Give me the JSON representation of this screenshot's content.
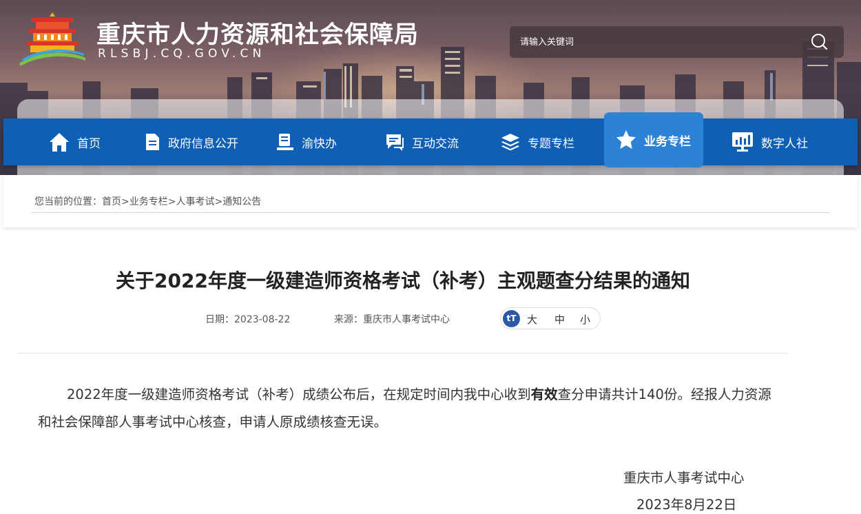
{
  "header": {
    "title": "重庆市人力资源和社会保障局",
    "domain": "RLSBJ.CQ.GOV.CN",
    "search": {
      "placeholder": "请输入关键词"
    }
  },
  "nav": {
    "items": [
      {
        "label": "首页",
        "icon": "home-icon"
      },
      {
        "label": "政府信息公开",
        "icon": "document-icon"
      },
      {
        "label": "渝快办",
        "icon": "service-icon"
      },
      {
        "label": "互动交流",
        "icon": "chat-icon"
      },
      {
        "label": "专题专栏",
        "icon": "layers-icon"
      },
      {
        "label": "业务专栏",
        "icon": "star-icon",
        "active": true
      },
      {
        "label": "数字人社",
        "icon": "monitor-chart-icon"
      }
    ]
  },
  "breadcrumb": {
    "prefix": "您当前的位置：",
    "items": [
      "首页",
      "业务专栏",
      "人事考试",
      "通知公告"
    ],
    "separator": ">"
  },
  "article": {
    "title": "关于2022年度一级建造师资格考试（补考）主观题查分结果的通知",
    "date": "日期：2023-08-22",
    "source": "来源：重庆市人事考试中心",
    "font_sizes": [
      "大",
      "中",
      "小"
    ],
    "body_before": "2022年度一级建造师资格考试（补考）成绩公布后，在规定时间内我中心收到",
    "body_bold": "有效",
    "body_after": "查分申请共计140份。经报人力资源和社会保障部人事考试中心核查，申请人原成绩核查无误。",
    "signature_org": "重庆市人事考试中心",
    "signature_date": "2023年8月22日"
  },
  "colors": {
    "nav_bg": "#0f60b4",
    "nav_active_bg": "#2b82d6",
    "font_switch_badge": "#2b59a8"
  }
}
